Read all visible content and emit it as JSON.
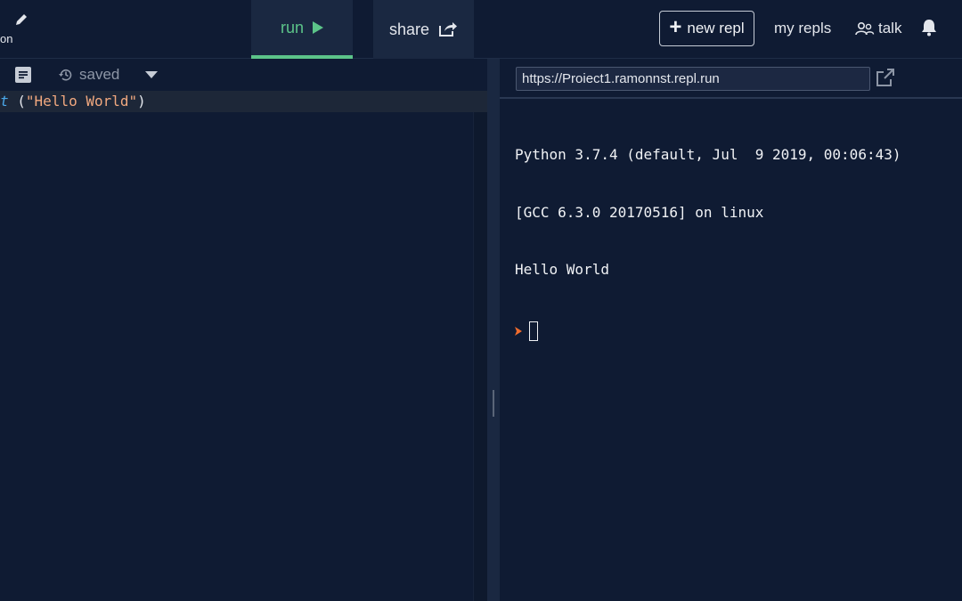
{
  "header": {
    "name_fragment": "on",
    "run_label": "run",
    "share_label": "share",
    "new_repl_label": "new repl",
    "my_repls_label": "my repls",
    "talk_label": "talk"
  },
  "editor": {
    "saved_label": "saved",
    "code": {
      "keyword_fragment": "t",
      "open": " (",
      "string": "\"Hello World\"",
      "close": ")"
    }
  },
  "console": {
    "url": "https://Proiect1.ramonnst.repl.run",
    "lines": [
      "Python 3.7.4 (default, Jul  9 2019, 00:06:43)",
      "[GCC 6.3.0 20170516] on linux",
      "Hello World"
    ]
  },
  "colors": {
    "accent_green": "#5cc489",
    "prompt_orange": "#f06c2d",
    "background": "#0f1b33"
  }
}
